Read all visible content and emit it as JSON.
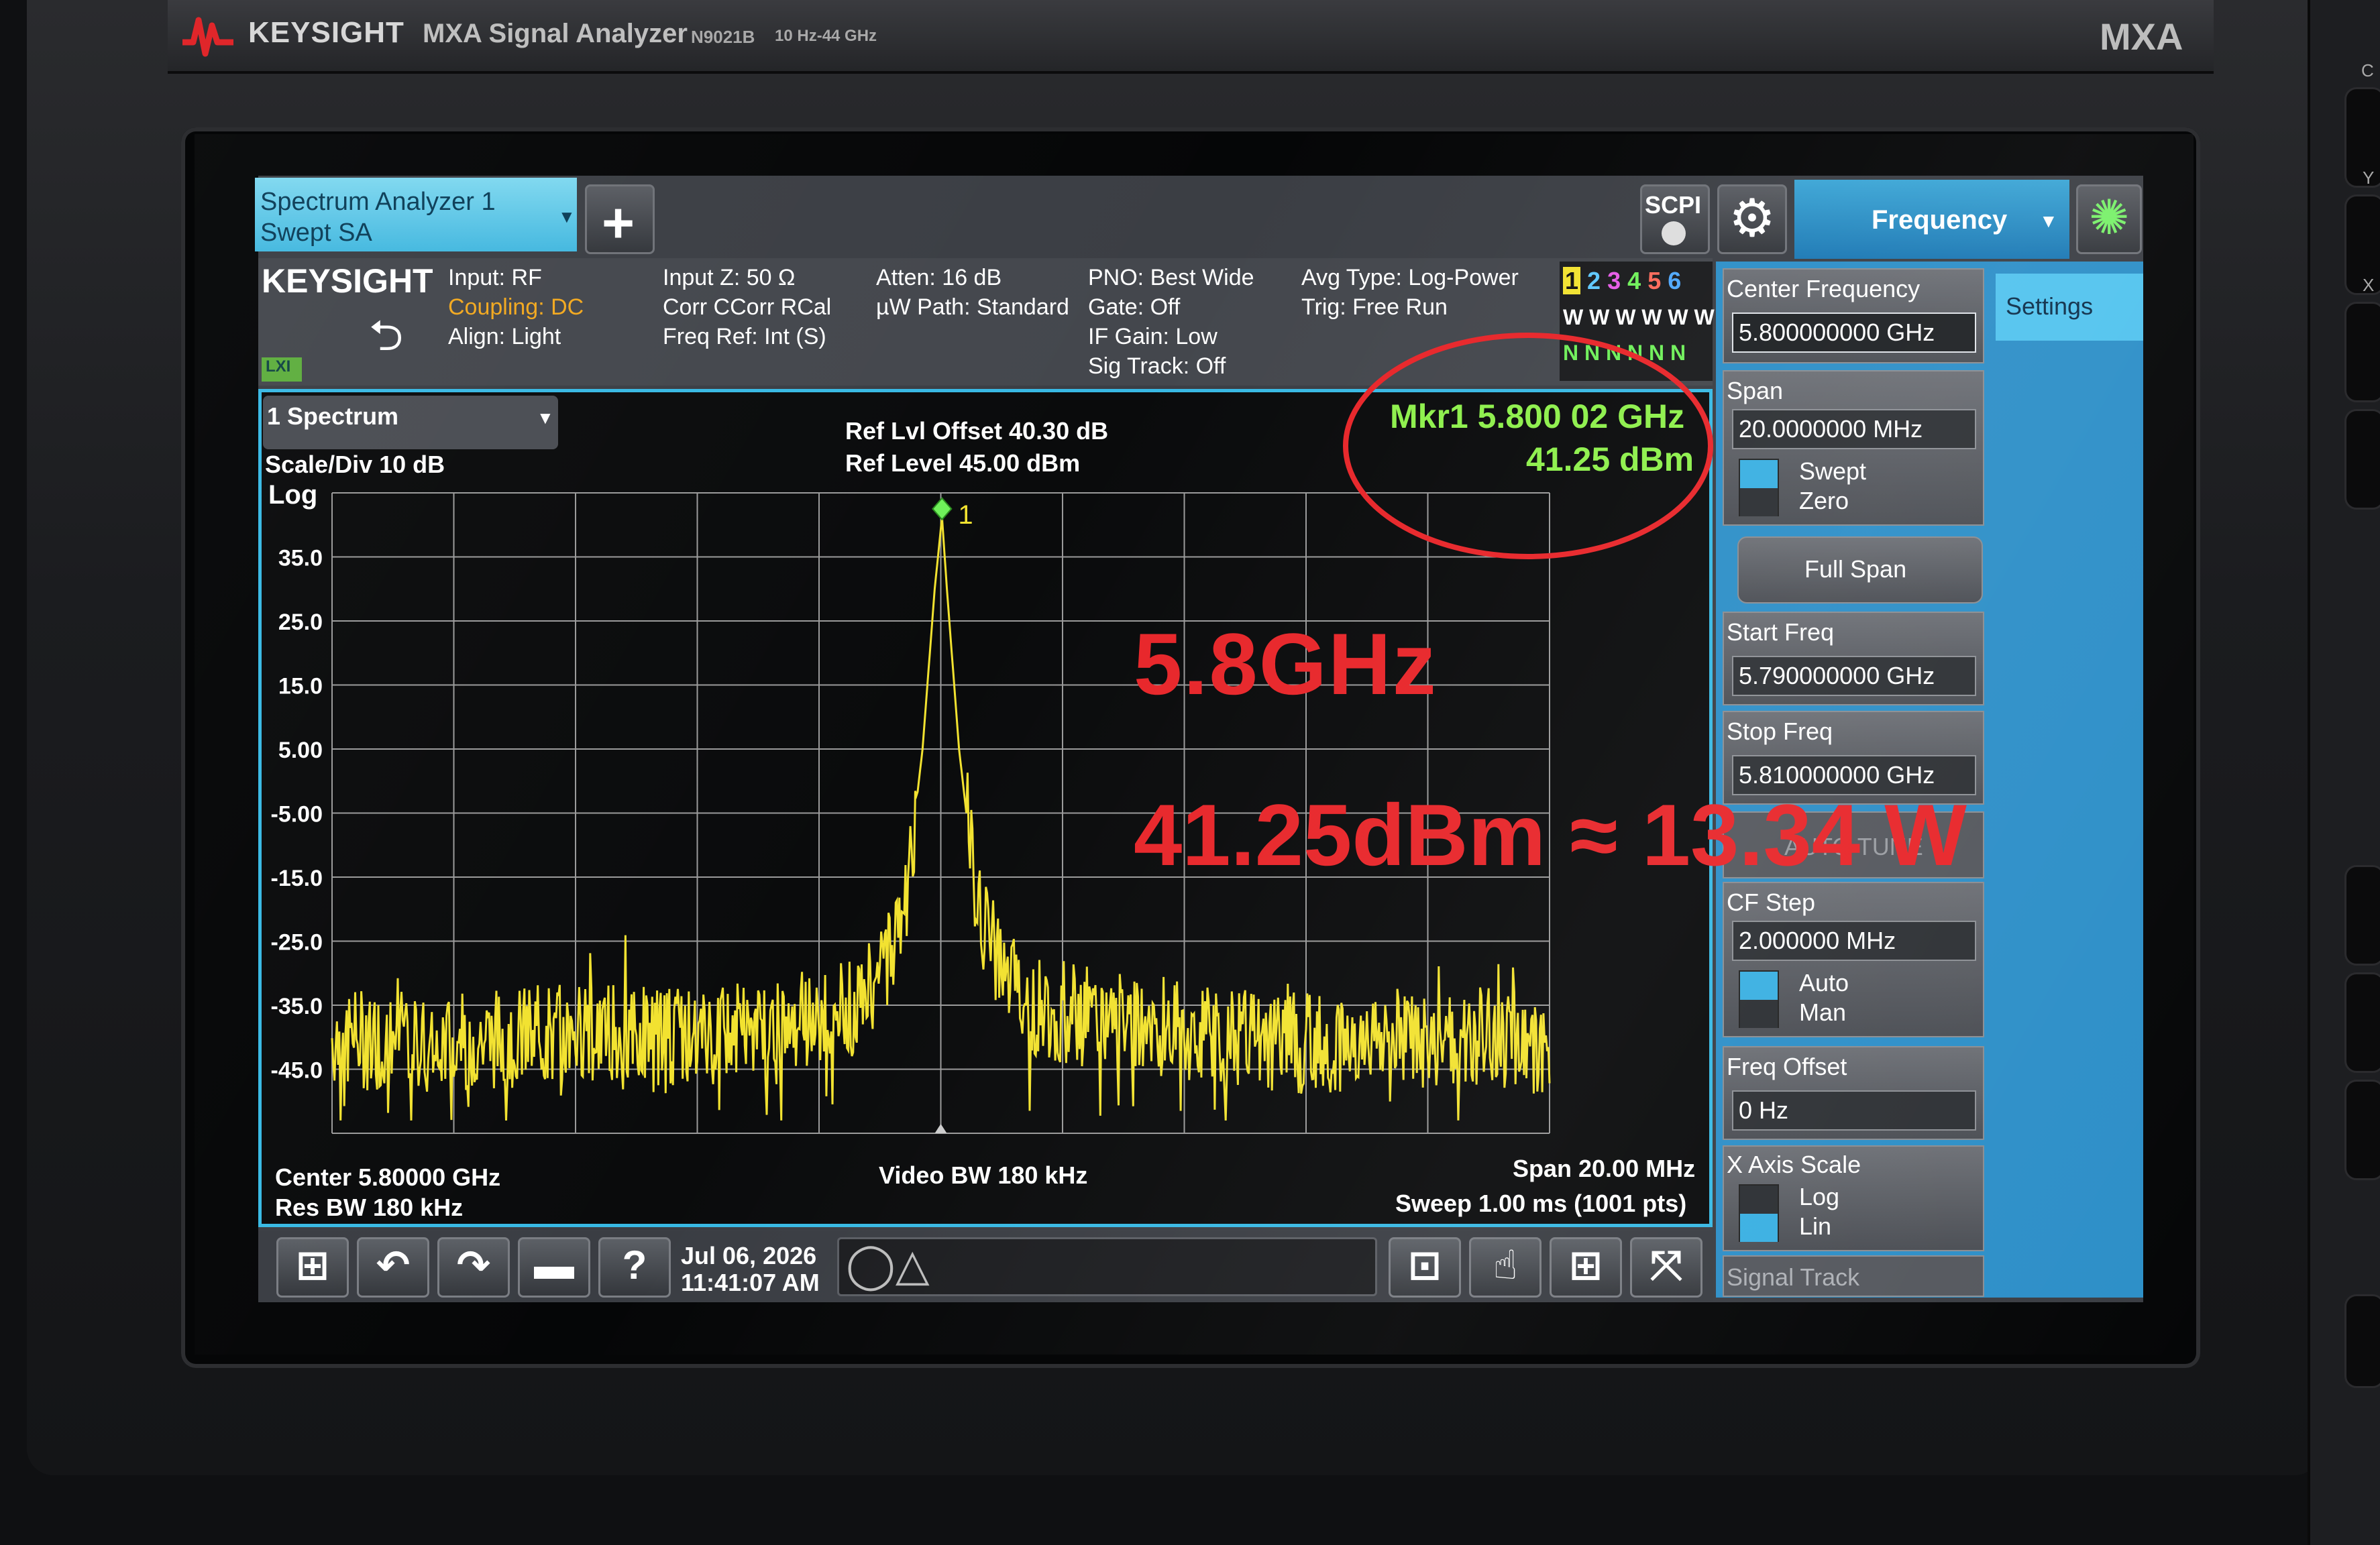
{
  "instrument": {
    "brand": "KEYSIGHT",
    "model_name": "MXA Signal Analyzer",
    "model_code": "N9021B",
    "freq_range": "10 Hz-44 GHz",
    "series_badge": "MXA",
    "side_letters": [
      "C",
      "Y",
      "X"
    ]
  },
  "mode_tab": {
    "line1": "Spectrum Analyzer 1",
    "line2": "Swept SA"
  },
  "toolbar_top": {
    "add_icon": "+",
    "scpi_label": "SCPI",
    "settings_icon": "⚙",
    "sync_icon": "✺",
    "active_menu": "Frequency"
  },
  "info_bar": {
    "brand": "KEYSIGHT",
    "lxi": "LXI",
    "col1": [
      "Input: RF",
      "Coupling: DC",
      "Align: Light"
    ],
    "col2": [
      "Input Z: 50 Ω",
      "Corr CCorr RCal",
      "Freq Ref: Int (S)"
    ],
    "col3": [
      "Atten: 16 dB",
      "µW Path: Standard"
    ],
    "col4": [
      "PNO: Best Wide",
      "Gate: Off",
      "IF Gain: Low",
      "Sig Track: Off"
    ],
    "col5": [
      "Avg Type: Log-Power",
      "Trig: Free Run"
    ],
    "trace_numbers": [
      "1",
      "2",
      "3",
      "4",
      "5",
      "6"
    ],
    "trace_colors": [
      "#f2e230",
      "#5ec8ff",
      "#e65ce6",
      "#6ff05a",
      "#ff6a5a",
      "#4fa8ff"
    ],
    "trace_types": "W W W W W W",
    "trace_detectors": "N N N N N N"
  },
  "graph": {
    "window_label": "1 Spectrum",
    "scale_div": "Scale/Div 10 dB",
    "scale_type": "Log",
    "ref_offset": "Ref Lvl Offset 40.30 dB",
    "ref_level": "Ref Level 45.00 dBm",
    "marker_freq": "Mkr1 5.800 02 GHz",
    "marker_amp": "41.25 dBm",
    "marker_label": "1",
    "y_tick_labels": [
      "35.0",
      "25.0",
      "15.0",
      "5.00",
      "-5.00",
      "-15.0",
      "-25.0",
      "-35.0",
      "-45.0"
    ],
    "center": "Center 5.80000 GHz",
    "res_bw": "Res BW 180 kHz",
    "video_bw": "Video BW 180 kHz",
    "span": "Span 20.00 MHz",
    "sweep": "Sweep 1.00 ms (1001 pts)"
  },
  "chart_data": {
    "type": "line",
    "title": "",
    "xlabel": "",
    "ylabel": "",
    "xlim": [
      5.79,
      5.81
    ],
    "ylim": [
      -55,
      45
    ],
    "x_unit": "GHz",
    "y_unit": "dBm",
    "grid": true,
    "series": [
      {
        "color": "#f2e230",
        "x": [
          5.79,
          5.7915,
          5.793,
          5.7945,
          5.796,
          5.7975,
          5.7985,
          5.799,
          5.7994,
          5.7997,
          5.7999,
          5.80002,
          5.8001,
          5.8003,
          5.8006,
          5.801,
          5.8015,
          5.803,
          5.8045,
          5.806,
          5.8075,
          5.809,
          5.81
        ],
        "y": [
          -40,
          -41,
          -40,
          -39,
          -40,
          -38,
          -36,
          -30,
          -20,
          5,
          30,
          41.25,
          30,
          5,
          -20,
          -30,
          -35,
          -38,
          -40,
          -41,
          -40,
          -40,
          -42
        ]
      }
    ]
  },
  "toolbar_bottom": {
    "date": "Jul 06, 2026",
    "time": "11:41:07 AM"
  },
  "menu": {
    "settings_tab": "Settings",
    "center_freq_title": "Center Frequency",
    "center_freq_value": "5.800000000 GHz",
    "span_title": "Span",
    "span_value": "20.0000000 MHz",
    "span_swept": "Swept",
    "span_zero": "Zero",
    "full_span": "Full Span",
    "start_freq_title": "Start Freq",
    "start_freq_value": "5.790000000 GHz",
    "stop_freq_title": "Stop Freq",
    "stop_freq_value": "5.810000000 GHz",
    "auto_tune": "AUTO TUNE",
    "cf_step_title": "CF Step",
    "cf_step_value": "2.000000 MHz",
    "cf_auto": "Auto",
    "cf_man": "Man",
    "freq_offset_title": "Freq Offset",
    "freq_offset_value": "0 Hz",
    "x_axis_title": "X Axis Scale",
    "x_log": "Log",
    "x_lin": "Lin",
    "signal_track": "Signal Track"
  },
  "annotations": {
    "frequency": "5.8GHz",
    "power": "41.25dBm ≈ 13.34 W",
    "color": "#e8262a"
  }
}
